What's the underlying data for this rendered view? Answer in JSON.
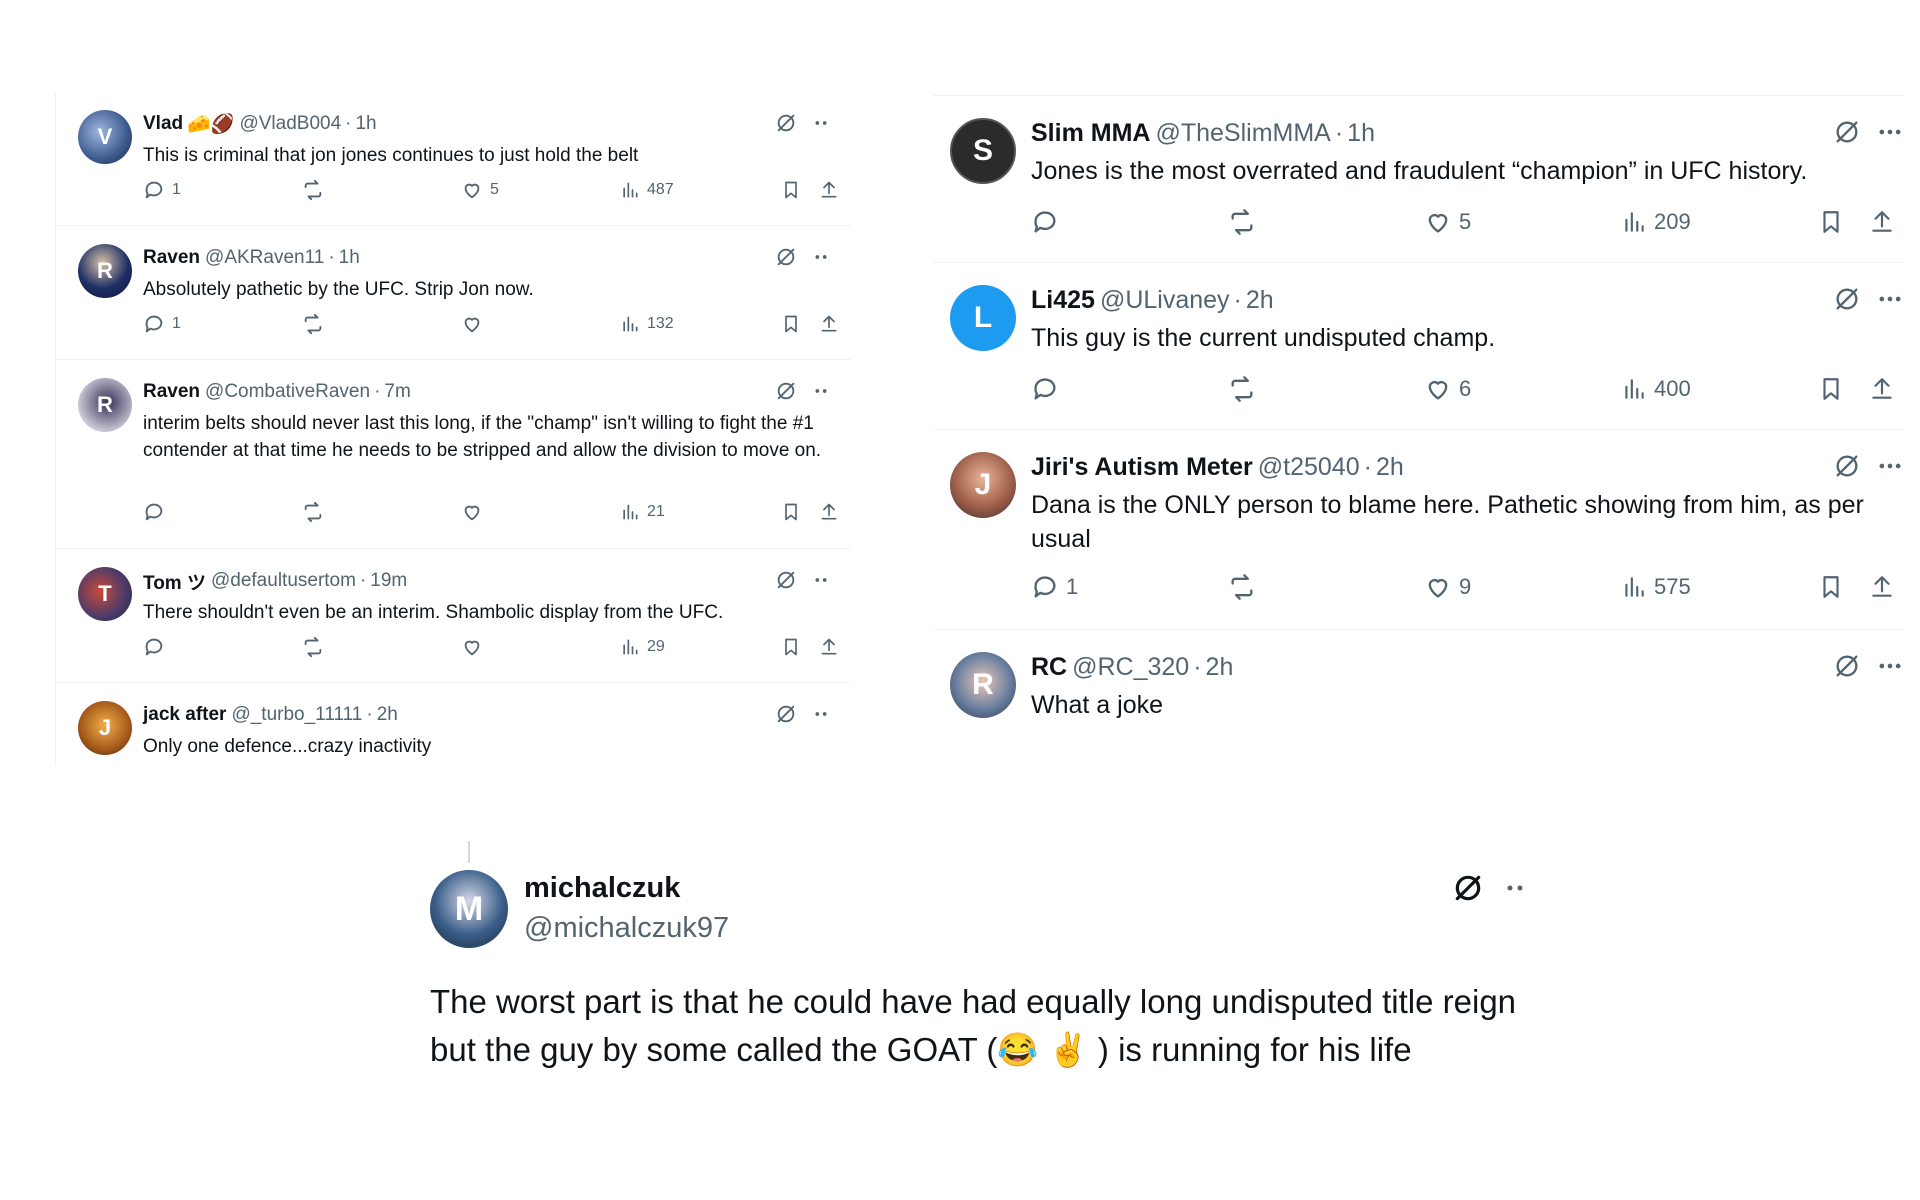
{
  "left_panel": {
    "tweets": [
      {
        "name": "Vlad",
        "emoji": "🧀🏈",
        "handle": "@VladB004",
        "time": "1h",
        "text": "This is criminal that jon jones continues to just hold the belt",
        "replies": "1",
        "reposts": "",
        "likes": "5",
        "views": "487",
        "avatar_color": "#4d6fa3",
        "avatar_letter": "V"
      },
      {
        "name": "Raven",
        "emoji": "",
        "handle": "@AKRaven11",
        "time": "1h",
        "text": "Absolutely pathetic by the UFC. Strip Jon now.",
        "replies": "1",
        "reposts": "",
        "likes": "",
        "views": "132",
        "avatar_color": "#1f2f66",
        "avatar_letter": "R"
      },
      {
        "name": "Raven",
        "emoji": "",
        "handle": "@CombativeRaven",
        "time": "7m",
        "text": "interim belts should never last this long, if the \"champ\" isn't willing to fight the #1 contender at that time he needs to be stripped and allow the division to move on.",
        "replies": "",
        "reposts": "",
        "likes": "",
        "views": "21",
        "avatar_color": "#8e8fa8",
        "avatar_letter": "R"
      },
      {
        "name": "Tom ツ",
        "emoji": "",
        "handle": "@defaultusertom",
        "time": "19m",
        "text": "There shouldn't even be an interim. Shambolic display from the UFC.",
        "replies": "",
        "reposts": "",
        "likes": "",
        "views": "29",
        "avatar_color": "#6b4d5a",
        "avatar_letter": "T"
      },
      {
        "name": "jack after",
        "emoji": "",
        "handle": "@_turbo_11111",
        "time": "2h",
        "text": "Only one defence...crazy inactivity",
        "replies": "",
        "reposts": "",
        "likes": "",
        "views": "",
        "avatar_color": "#b5741e",
        "avatar_letter": "J"
      }
    ]
  },
  "right_panel": {
    "tweets": [
      {
        "name": "Slim MMA",
        "handle": "@TheSlimMMA",
        "time": "1h",
        "text": "Jones is the most overrated and fraudulent “champion” in UFC history.",
        "replies": "",
        "reposts": "",
        "likes": "5",
        "views": "209",
        "avatar_color": "#2a2a2a",
        "avatar_letter": "S"
      },
      {
        "name": "Li425",
        "handle": "@ULivaney",
        "time": "2h",
        "text": "This guy is the current undisputed champ.",
        "replies": "",
        "reposts": "",
        "likes": "6",
        "views": "400",
        "avatar_color": "#1d9bf0",
        "avatar_letter": "L"
      },
      {
        "name": "Jiri's Autism Meter",
        "handle": "@t25040",
        "time": "2h",
        "text": "Dana is the ONLY person to blame here. Pathetic showing from him, as per usual",
        "replies": "1",
        "reposts": "",
        "likes": "9",
        "views": "575",
        "avatar_color": "#8a5a48",
        "avatar_letter": "J"
      },
      {
        "name": "RC",
        "handle": "@RC_320",
        "time": "2h",
        "text": "What a joke",
        "avatar_color": "#5d6f86",
        "avatar_letter": "R"
      }
    ]
  },
  "bottom_tweet": {
    "name": "michalczuk",
    "handle": "@michalczuk97",
    "text": "The worst part is that he could have had equally long undisputed title reign but the guy by some called the GOAT (😂 ✌️ ) is running for his life",
    "avatar_color": "#2f4f6f",
    "avatar_letter": "M"
  },
  "icons": {
    "grok": "grok-icon",
    "more": "more-icon",
    "reply": "reply-icon",
    "repost": "repost-icon",
    "like": "like-icon",
    "views": "views-icon",
    "bookmark": "bookmark-icon",
    "share": "share-icon"
  }
}
